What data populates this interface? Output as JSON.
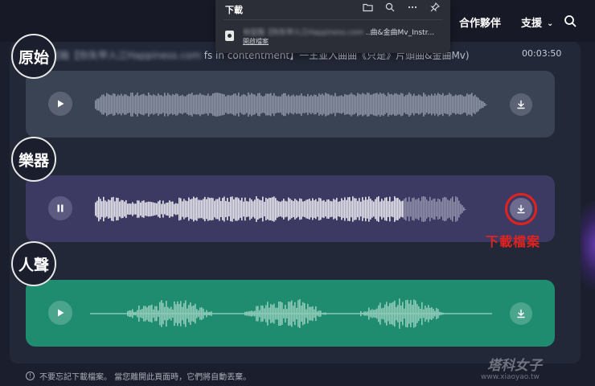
{
  "nav": {
    "partners": "合作夥伴",
    "support": "支援",
    "search_icon": "search-icon"
  },
  "download_popup": {
    "title": "下載",
    "file_name_blurred": "林宜融【你失甲入江Happiness.com",
    "file_name_visible": "..曲&金曲Mv_Instr...",
    "open_link": "開啟檔案",
    "icons": [
      "folder-icon",
      "search-icon",
      "more-icon",
      "pin-icon"
    ]
  },
  "song": {
    "title_blurred": "林宜融【你失甲入江Happiness.com",
    "title_visible": "fs in contentment】一王並入曲曲《只是》片頭曲&金曲Mv)",
    "duration": "00:03:50"
  },
  "tracks": [
    {
      "label": "原始",
      "state": "paused",
      "progress": 0
    },
    {
      "label": "樂器",
      "state": "playing",
      "progress": 0.78
    },
    {
      "label": "人聲",
      "state": "paused",
      "progress": 0
    }
  ],
  "annotation": "下載檔案",
  "footer_note": "不要忘記下載檔案。 當您離開此頁面時，它們將自動丟棄。",
  "watermark": {
    "big": "塔科女子",
    "small": "www.xiaoyao.tw"
  },
  "colors": {
    "background": "#1b1f2d",
    "panel": "#232838",
    "track_original": "#3a4354",
    "track_instrument": "#3c3a63",
    "track_vocal": "#1f8c70",
    "highlight_red": "#e0231f"
  }
}
